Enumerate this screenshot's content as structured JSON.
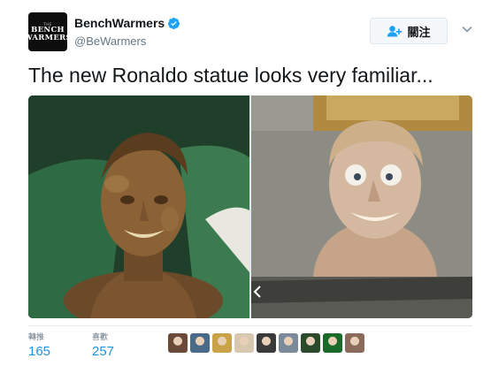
{
  "account": {
    "display_name": "BenchWarmers",
    "handle": "@BeWarmers",
    "avatar_text": {
      "top": "THE",
      "line1": "BENCH",
      "line2": "WARMERS"
    },
    "verified": true
  },
  "follow_button": {
    "label": "關注",
    "icon": "add-user-icon"
  },
  "menu_icon": "chevron-down-icon",
  "tweet": {
    "text": "The new Ronaldo statue looks very familiar..."
  },
  "media": {
    "photos": [
      {
        "subject": "bronze bust"
      },
      {
        "subject": "clay figure"
      }
    ]
  },
  "stats": {
    "retweets": {
      "label": "轉推",
      "value": "165"
    },
    "likes": {
      "label": "喜歡",
      "value": "257"
    }
  },
  "likers": [
    {
      "color": "#6b4a3a"
    },
    {
      "color": "#4a6a8a"
    },
    {
      "color": "#c9a24a"
    },
    {
      "color": "#d8c8b0"
    },
    {
      "color": "#3a3a3a"
    },
    {
      "color": "#7a8a9a"
    },
    {
      "color": "#2a4a2a"
    },
    {
      "color": "#1a6a2a"
    },
    {
      "color": "#8a6a5a"
    }
  ],
  "colors": {
    "accent": "#1b95e0",
    "verified": "#1da1f2"
  }
}
